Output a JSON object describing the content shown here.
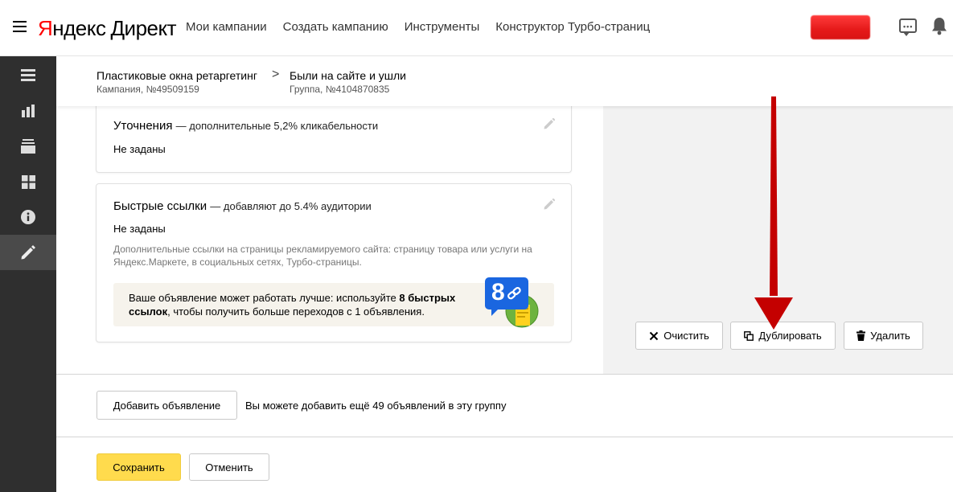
{
  "header": {
    "logo_ya": "Я",
    "logo_ndex": "ндекс",
    "logo_direct": "Директ",
    "nav": [
      "Мои кампании",
      "Создать кампанию",
      "Инструменты",
      "Конструктор Турбо-страниц"
    ],
    "chat_dots": "•••"
  },
  "sidebar": {
    "items": [
      "menu-list-icon",
      "statistics-icon",
      "layers-icon",
      "grid-icon",
      "info-icon",
      "edit-icon"
    ],
    "active_index": 5
  },
  "breadcrumbs": {
    "campaign_title": "Пластиковые окна ретаргетинг",
    "campaign_sub": "Кампания, №49509159",
    "group_title": "Были на сайте и ушли",
    "group_sub": "Группа, №4104870835",
    "separator": ">"
  },
  "refinements": {
    "title": "Уточнения",
    "subtitle": "— дополнительные 5,2% кликабельности",
    "value": "Не заданы"
  },
  "quicklinks": {
    "title": "Быстрые ссылки",
    "subtitle": "— добавляют до 5.4% аудитории",
    "value": "Не заданы",
    "description": "Дополнительные ссылки на страницы рекламируемого сайта: страницу товара или услуги на Яндекс.Маркете, в социальных сетях, Турбо-страницы.",
    "promo_text_1": "Ваше объявление может работать лучше: используйте ",
    "promo_bold": "8 быстрых ссылок",
    "promo_text_2": ", чтобы получить больше переходов с 1 объявления.",
    "badge_number": "8"
  },
  "actions": {
    "clear": "Очистить",
    "duplicate": "Дублировать",
    "delete": "Удалить"
  },
  "footer": {
    "add_ad": "Добавить объявление",
    "add_hint": "Вы можете добавить ещё 49 объявлений в эту группу",
    "save": "Сохранить",
    "cancel": "Отменить"
  },
  "colors": {
    "logo_red": "#ff0000",
    "save_yellow": "#ffdb4d",
    "sidebar": "#2f2f2f",
    "annotation_arrow": "#c40000",
    "badge_blue": "#1a66e0"
  }
}
